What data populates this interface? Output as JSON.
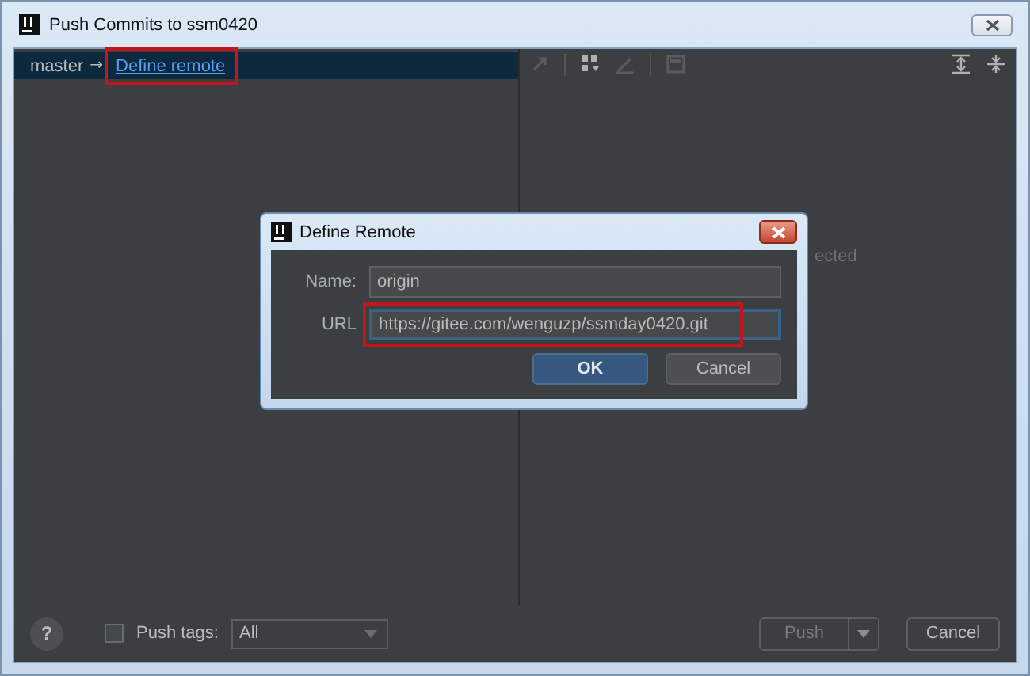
{
  "window": {
    "title": "Push Commits to ssm0420"
  },
  "branch_row": {
    "branch": "master",
    "arrow": "→",
    "link": "Define remote",
    "selected": true,
    "highlighted": true
  },
  "details_panel": {
    "text": "ected"
  },
  "footer": {
    "help": "?",
    "push_tags": {
      "label": "Push tags:",
      "checked": false
    },
    "tags_dropdown": {
      "value": "All"
    },
    "buttons": [
      {
        "label": "Push",
        "disabled": true,
        "has_dropdown": true
      },
      {
        "label": "Cancel",
        "disabled": false,
        "has_dropdown": false
      }
    ]
  },
  "dialog": {
    "title": "Define Remote",
    "fields": [
      {
        "label": "Name:",
        "value": "origin",
        "focused": false,
        "highlighted": false
      },
      {
        "label": "URL",
        "value": "https://gitee.com/wenguzp/ssmday0420.git",
        "focused": true,
        "highlighted": true
      }
    ],
    "buttons": [
      {
        "label": "OK",
        "default": true
      },
      {
        "label": "Cancel",
        "default": false
      }
    ]
  }
}
